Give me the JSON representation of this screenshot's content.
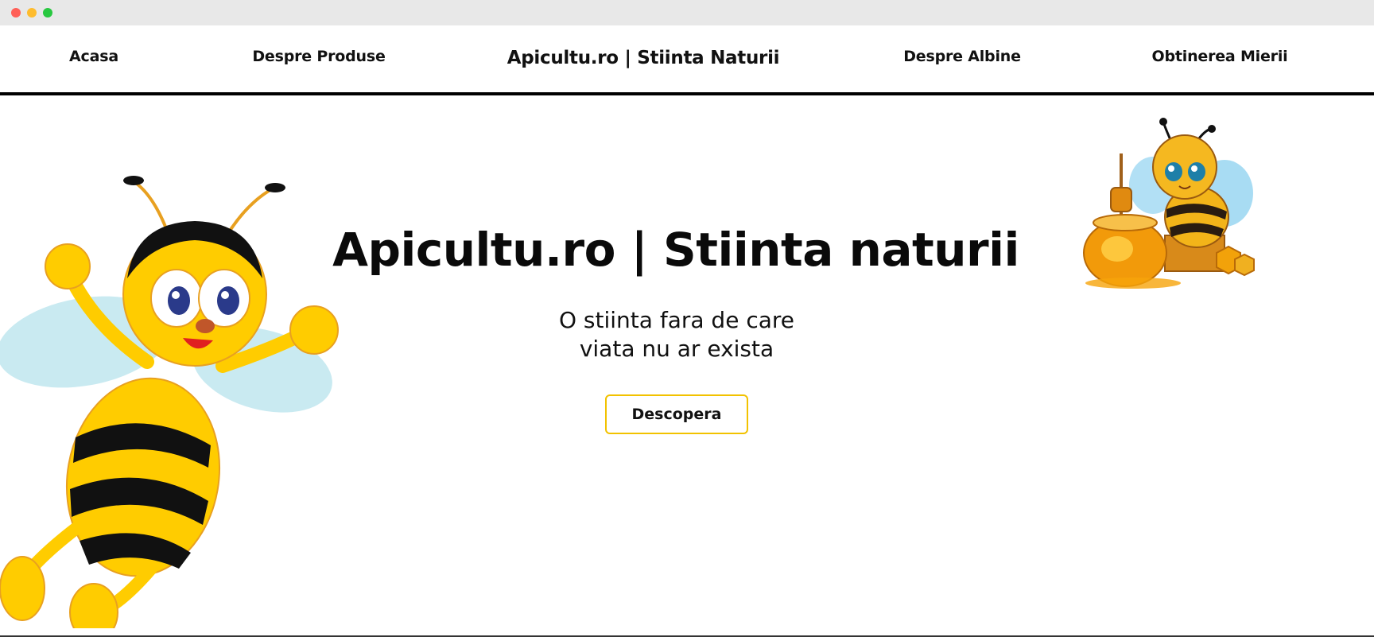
{
  "window": {
    "controls": [
      "close",
      "minimize",
      "maximize"
    ]
  },
  "nav": {
    "links": [
      {
        "label": "Acasa"
      },
      {
        "label": "Despre Produse"
      },
      {
        "label": "Despre Albine"
      },
      {
        "label": "Obtinerea Mierii"
      }
    ],
    "brand": "Apicultu.ro | Stiinta Naturii"
  },
  "hero": {
    "title": "Apicultu.ro | Stiinta naturii",
    "subtitle_line1": "O stiinta fara de care",
    "subtitle_line2": "viata nu ar exista",
    "button_label": "Descopera"
  },
  "images": {
    "left": "cartoon-bee-waving-illustration",
    "right": "cartoon-bee-with-honey-pot-illustration"
  },
  "colors": {
    "accent": "#f2c200",
    "nav_border": "#000000",
    "bee_yellow": "#ffcc00",
    "bee_black": "#111111"
  }
}
